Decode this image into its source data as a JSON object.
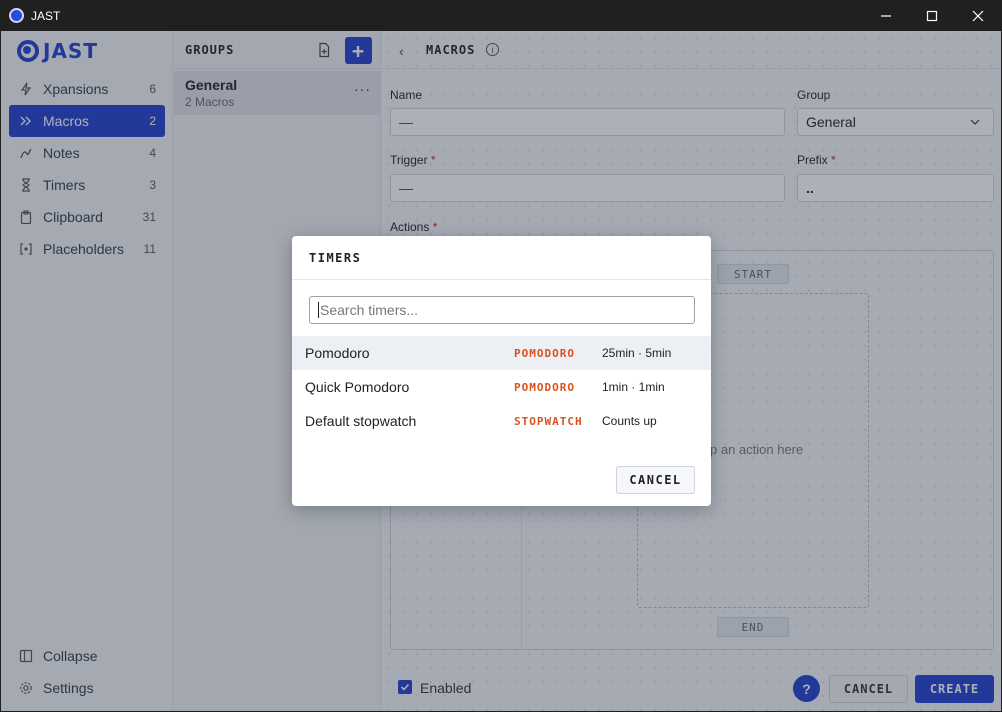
{
  "window": {
    "title": "JAST",
    "controls": [
      "minimize-icon",
      "maximize-icon",
      "close-icon"
    ]
  },
  "brand": {
    "name": "JAST"
  },
  "sidebar": {
    "items": [
      {
        "label": "Xpansions",
        "count": "6",
        "icon": "bolt-icon"
      },
      {
        "label": "Macros",
        "count": "2",
        "icon": "macros-icon",
        "active": true
      },
      {
        "label": "Notes",
        "count": "4",
        "icon": "pen-icon"
      },
      {
        "label": "Timers",
        "count": "3",
        "icon": "hourglass-icon"
      },
      {
        "label": "Clipboard",
        "count": "31",
        "icon": "clipboard-icon"
      },
      {
        "label": "Placeholders",
        "count": "11",
        "icon": "placeholder-icon"
      }
    ],
    "bottom": [
      {
        "label": "Collapse",
        "icon": "collapse-icon"
      },
      {
        "label": "Settings",
        "icon": "gear-icon"
      }
    ]
  },
  "groups": {
    "title": "GROUPS",
    "add_label": "+",
    "items": [
      {
        "name": "General",
        "subtitle": "2 Macros",
        "more": "···"
      }
    ]
  },
  "main": {
    "back": "‹",
    "title": "MACROS",
    "info": "i",
    "name_label": "Name",
    "name_value": "—",
    "group_label": "Group",
    "group_value": "General",
    "trigger_label": "Trigger",
    "trigger_value": "—",
    "prefix_label": "Prefix",
    "prefix_value": "..",
    "actions_label": "Actions",
    "required": "*",
    "start": "START",
    "end": "END",
    "drop_hint": "op an action here",
    "enabled_label": "Enabled",
    "help": "?",
    "cancel": "CANCEL",
    "create": "CREATE"
  },
  "modal": {
    "title": "TIMERS",
    "search_placeholder": "Search timers...",
    "timers": [
      {
        "name": "Pomodoro",
        "type": "POMODORO",
        "desc": "25min · 5min",
        "selected": true
      },
      {
        "name": "Quick Pomodoro",
        "type": "POMODORO",
        "desc": "1min · 1min"
      },
      {
        "name": "Default stopwatch",
        "type": "STOPWATCH",
        "desc": "Counts up"
      }
    ],
    "cancel": "CANCEL"
  },
  "colors": {
    "accent": "#1f3fd0",
    "timer_type": "#d9531e",
    "required": "#c02626"
  }
}
